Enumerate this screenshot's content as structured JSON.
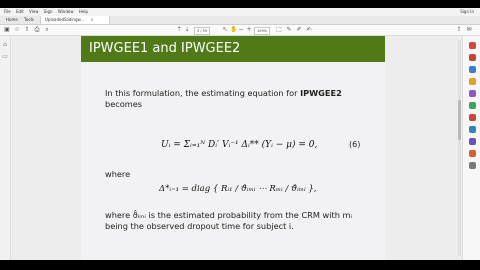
{
  "menu": {
    "items": [
      "File",
      "Edit",
      "View",
      "Sign",
      "Window",
      "Help"
    ],
    "signin": "Sign In"
  },
  "tabs": {
    "home": "Home",
    "tools": "Tools",
    "doc": "UploadedSlidingw..."
  },
  "toolbar": {
    "page_current": "5",
    "page_total": "/ 59",
    "zoom": "109%"
  },
  "slide": {
    "title": "IPWGEE1 and IPWGEE2",
    "para1_a": "In this formulation, the estimating equation for ",
    "para1_b": "IPWGEE2",
    "para1_c": "becomes",
    "eq1": "Uᵢ = Σᵢ₌₁ᴺ Dᵢ′ Vᵢ⁻¹ Δᵢ** (Yᵢ − μ) = 0,",
    "eq1_number": "(6)",
    "where": "where",
    "eq2": "Δ*ᵢ₌₁ = diag { Rᵢ₁ / ϑ̂ᵢₘᵢ ⋯ Rₘᵢ / ϑ̂ᵢₘᵢ },",
    "para2_line1": "where ϑ̂ᵢₘᵢ is the estimated probability from the CRM with mᵢ",
    "para2_line2": "being the observed dropout time for subject i."
  }
}
